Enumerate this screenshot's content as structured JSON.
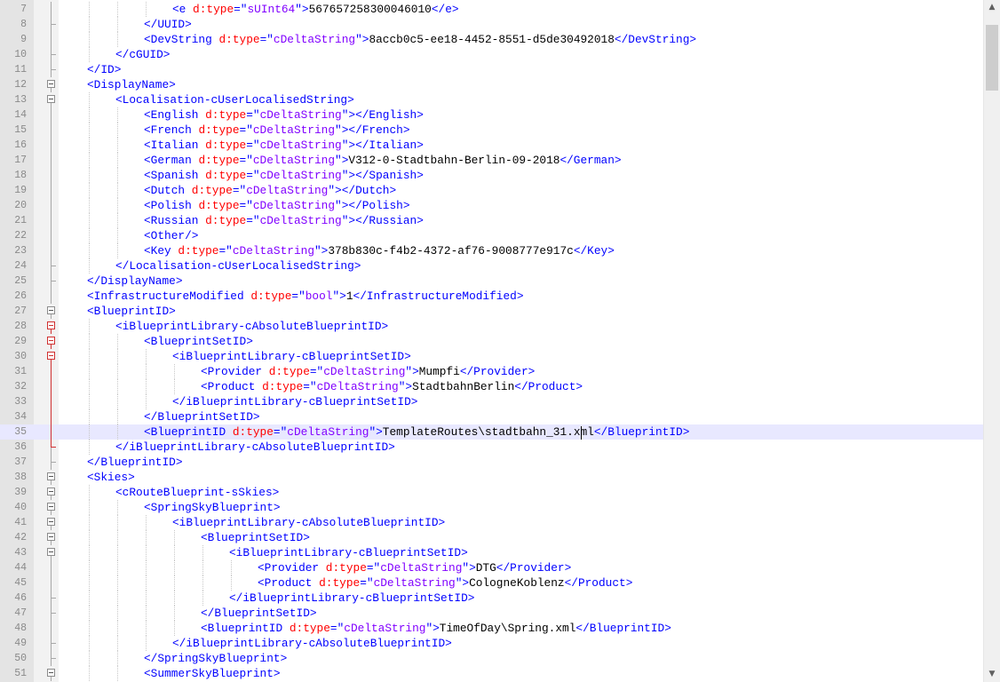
{
  "editor": {
    "caret_line": 35,
    "lines": [
      {
        "n": "7",
        "indent": 4,
        "fold": "line",
        "s": [
          [
            "t",
            "<e "
          ],
          [
            "a",
            "d:type"
          ],
          [
            "t",
            "=\""
          ],
          [
            "v",
            "sUInt64"
          ],
          [
            "t",
            "\">"
          ],
          [
            "x",
            "567657258300046010"
          ],
          [
            "t",
            "</e>"
          ]
        ]
      },
      {
        "n": "8",
        "indent": 3,
        "fold": "end",
        "s": [
          [
            "t",
            "</UUID>"
          ]
        ]
      },
      {
        "n": "9",
        "indent": 3,
        "fold": "line",
        "s": [
          [
            "t",
            "<DevString "
          ],
          [
            "a",
            "d:type"
          ],
          [
            "t",
            "=\""
          ],
          [
            "v",
            "cDeltaString"
          ],
          [
            "t",
            "\">"
          ],
          [
            "x",
            "8accb0c5-ee18-4452-8551-d5de30492018"
          ],
          [
            "t",
            "</DevString>"
          ]
        ]
      },
      {
        "n": "10",
        "indent": 2,
        "fold": "end",
        "s": [
          [
            "t",
            "</cGUID>"
          ]
        ]
      },
      {
        "n": "11",
        "indent": 1,
        "fold": "end",
        "s": [
          [
            "t",
            "</ID>"
          ]
        ]
      },
      {
        "n": "12",
        "indent": 1,
        "fold": "box",
        "s": [
          [
            "t",
            "<DisplayName>"
          ]
        ]
      },
      {
        "n": "13",
        "indent": 2,
        "fold": "box",
        "s": [
          [
            "t",
            "<Localisation-cUserLocalisedString>"
          ]
        ]
      },
      {
        "n": "14",
        "indent": 3,
        "fold": "line",
        "s": [
          [
            "t",
            "<English "
          ],
          [
            "a",
            "d:type"
          ],
          [
            "t",
            "=\""
          ],
          [
            "v",
            "cDeltaString"
          ],
          [
            "t",
            "\"></English>"
          ]
        ]
      },
      {
        "n": "15",
        "indent": 3,
        "fold": "line",
        "s": [
          [
            "t",
            "<French "
          ],
          [
            "a",
            "d:type"
          ],
          [
            "t",
            "=\""
          ],
          [
            "v",
            "cDeltaString"
          ],
          [
            "t",
            "\"></French>"
          ]
        ]
      },
      {
        "n": "16",
        "indent": 3,
        "fold": "line",
        "s": [
          [
            "t",
            "<Italian "
          ],
          [
            "a",
            "d:type"
          ],
          [
            "t",
            "=\""
          ],
          [
            "v",
            "cDeltaString"
          ],
          [
            "t",
            "\"></Italian>"
          ]
        ]
      },
      {
        "n": "17",
        "indent": 3,
        "fold": "line",
        "s": [
          [
            "t",
            "<German "
          ],
          [
            "a",
            "d:type"
          ],
          [
            "t",
            "=\""
          ],
          [
            "v",
            "cDeltaString"
          ],
          [
            "t",
            "\">"
          ],
          [
            "x",
            "V312-0-Stadtbahn-Berlin-09-2018"
          ],
          [
            "t",
            "</German>"
          ]
        ]
      },
      {
        "n": "18",
        "indent": 3,
        "fold": "line",
        "s": [
          [
            "t",
            "<Spanish "
          ],
          [
            "a",
            "d:type"
          ],
          [
            "t",
            "=\""
          ],
          [
            "v",
            "cDeltaString"
          ],
          [
            "t",
            "\"></Spanish>"
          ]
        ]
      },
      {
        "n": "19",
        "indent": 3,
        "fold": "line",
        "s": [
          [
            "t",
            "<Dutch "
          ],
          [
            "a",
            "d:type"
          ],
          [
            "t",
            "=\""
          ],
          [
            "v",
            "cDeltaString"
          ],
          [
            "t",
            "\"></Dutch>"
          ]
        ]
      },
      {
        "n": "20",
        "indent": 3,
        "fold": "line",
        "s": [
          [
            "t",
            "<Polish "
          ],
          [
            "a",
            "d:type"
          ],
          [
            "t",
            "=\""
          ],
          [
            "v",
            "cDeltaString"
          ],
          [
            "t",
            "\"></Polish>"
          ]
        ]
      },
      {
        "n": "21",
        "indent": 3,
        "fold": "line",
        "s": [
          [
            "t",
            "<Russian "
          ],
          [
            "a",
            "d:type"
          ],
          [
            "t",
            "=\""
          ],
          [
            "v",
            "cDeltaString"
          ],
          [
            "t",
            "\"></Russian>"
          ]
        ]
      },
      {
        "n": "22",
        "indent": 3,
        "fold": "line",
        "s": [
          [
            "t",
            "<Other/>"
          ]
        ]
      },
      {
        "n": "23",
        "indent": 3,
        "fold": "line",
        "s": [
          [
            "t",
            "<Key "
          ],
          [
            "a",
            "d:type"
          ],
          [
            "t",
            "=\""
          ],
          [
            "v",
            "cDeltaString"
          ],
          [
            "t",
            "\">"
          ],
          [
            "x",
            "378b830c-f4b2-4372-af76-9008777e917c"
          ],
          [
            "t",
            "</Key>"
          ]
        ]
      },
      {
        "n": "24",
        "indent": 2,
        "fold": "end",
        "s": [
          [
            "t",
            "</Localisation-cUserLocalisedString>"
          ]
        ]
      },
      {
        "n": "25",
        "indent": 1,
        "fold": "end",
        "s": [
          [
            "t",
            "</DisplayName>"
          ]
        ]
      },
      {
        "n": "26",
        "indent": 1,
        "fold": "line",
        "s": [
          [
            "t",
            "<InfrastructureModified "
          ],
          [
            "a",
            "d:type"
          ],
          [
            "t",
            "=\""
          ],
          [
            "v",
            "bool"
          ],
          [
            "t",
            "\">"
          ],
          [
            "x",
            "1"
          ],
          [
            "t",
            "</InfrastructureModified>"
          ]
        ]
      },
      {
        "n": "27",
        "indent": 1,
        "fold": "box",
        "s": [
          [
            "t",
            "<BlueprintID>"
          ]
        ]
      },
      {
        "n": "28",
        "indent": 2,
        "fold": "box-red",
        "s": [
          [
            "t",
            "<iBlueprintLibrary-cAbsoluteBlueprintID>"
          ]
        ]
      },
      {
        "n": "29",
        "indent": 3,
        "fold": "box-red",
        "s": [
          [
            "t",
            "<BlueprintSetID>"
          ]
        ]
      },
      {
        "n": "30",
        "indent": 4,
        "fold": "box-red",
        "s": [
          [
            "t",
            "<iBlueprintLibrary-cBlueprintSetID>"
          ]
        ]
      },
      {
        "n": "31",
        "indent": 5,
        "fold": "line-red",
        "s": [
          [
            "t",
            "<Provider "
          ],
          [
            "a",
            "d:type"
          ],
          [
            "t",
            "=\""
          ],
          [
            "v",
            "cDeltaString"
          ],
          [
            "t",
            "\">"
          ],
          [
            "x",
            "Mumpfi"
          ],
          [
            "t",
            "</Provider>"
          ]
        ]
      },
      {
        "n": "32",
        "indent": 5,
        "fold": "line-red",
        "s": [
          [
            "t",
            "<Product "
          ],
          [
            "a",
            "d:type"
          ],
          [
            "t",
            "=\""
          ],
          [
            "v",
            "cDeltaString"
          ],
          [
            "t",
            "\">"
          ],
          [
            "x",
            "StadtbahnBerlin"
          ],
          [
            "t",
            "</Product>"
          ]
        ]
      },
      {
        "n": "33",
        "indent": 4,
        "fold": "line-red",
        "s": [
          [
            "t",
            "</iBlueprintLibrary-cBlueprintSetID>"
          ]
        ]
      },
      {
        "n": "34",
        "indent": 3,
        "fold": "line-red",
        "s": [
          [
            "t",
            "</BlueprintSetID>"
          ]
        ]
      },
      {
        "n": "35",
        "indent": 3,
        "fold": "line-red",
        "s": [
          [
            "t",
            "<BlueprintID "
          ],
          [
            "a",
            "d:type"
          ],
          [
            "t",
            "=\""
          ],
          [
            "v",
            "cDeltaString"
          ],
          [
            "t",
            "\">"
          ],
          [
            "x",
            "TemplateRoutes\\stadtbahn_31.xml"
          ],
          [
            "t",
            "</BlueprintID>"
          ]
        ]
      },
      {
        "n": "36",
        "indent": 2,
        "fold": "end-red",
        "s": [
          [
            "t",
            "</iBlueprintLibrary-cAbsoluteBlueprintID>"
          ]
        ]
      },
      {
        "n": "37",
        "indent": 1,
        "fold": "end",
        "s": [
          [
            "t",
            "</BlueprintID>"
          ]
        ]
      },
      {
        "n": "38",
        "indent": 1,
        "fold": "box",
        "s": [
          [
            "t",
            "<Skies>"
          ]
        ]
      },
      {
        "n": "39",
        "indent": 2,
        "fold": "box",
        "s": [
          [
            "t",
            "<cRouteBlueprint-sSkies>"
          ]
        ]
      },
      {
        "n": "40",
        "indent": 3,
        "fold": "box",
        "s": [
          [
            "t",
            "<SpringSkyBlueprint>"
          ]
        ]
      },
      {
        "n": "41",
        "indent": 4,
        "fold": "box",
        "s": [
          [
            "t",
            "<iBlueprintLibrary-cAbsoluteBlueprintID>"
          ]
        ]
      },
      {
        "n": "42",
        "indent": 5,
        "fold": "box",
        "s": [
          [
            "t",
            "<BlueprintSetID>"
          ]
        ]
      },
      {
        "n": "43",
        "indent": 6,
        "fold": "box",
        "s": [
          [
            "t",
            "<iBlueprintLibrary-cBlueprintSetID>"
          ]
        ]
      },
      {
        "n": "44",
        "indent": 7,
        "fold": "line",
        "s": [
          [
            "t",
            "<Provider "
          ],
          [
            "a",
            "d:type"
          ],
          [
            "t",
            "=\""
          ],
          [
            "v",
            "cDeltaString"
          ],
          [
            "t",
            "\">"
          ],
          [
            "x",
            "DTG"
          ],
          [
            "t",
            "</Provider>"
          ]
        ]
      },
      {
        "n": "45",
        "indent": 7,
        "fold": "line",
        "s": [
          [
            "t",
            "<Product "
          ],
          [
            "a",
            "d:type"
          ],
          [
            "t",
            "=\""
          ],
          [
            "v",
            "cDeltaString"
          ],
          [
            "t",
            "\">"
          ],
          [
            "x",
            "CologneKoblenz"
          ],
          [
            "t",
            "</Product>"
          ]
        ]
      },
      {
        "n": "46",
        "indent": 6,
        "fold": "end",
        "s": [
          [
            "t",
            "</iBlueprintLibrary-cBlueprintSetID>"
          ]
        ]
      },
      {
        "n": "47",
        "indent": 5,
        "fold": "end",
        "s": [
          [
            "t",
            "</BlueprintSetID>"
          ]
        ]
      },
      {
        "n": "48",
        "indent": 5,
        "fold": "line",
        "s": [
          [
            "t",
            "<BlueprintID "
          ],
          [
            "a",
            "d:type"
          ],
          [
            "t",
            "=\""
          ],
          [
            "v",
            "cDeltaString"
          ],
          [
            "t",
            "\">"
          ],
          [
            "x",
            "TimeOfDay\\Spring.xml"
          ],
          [
            "t",
            "</BlueprintID>"
          ]
        ]
      },
      {
        "n": "49",
        "indent": 4,
        "fold": "end",
        "s": [
          [
            "t",
            "</iBlueprintLibrary-cAbsoluteBlueprintID>"
          ]
        ]
      },
      {
        "n": "50",
        "indent": 3,
        "fold": "end",
        "s": [
          [
            "t",
            "</SpringSkyBlueprint>"
          ]
        ]
      },
      {
        "n": "51",
        "indent": 3,
        "fold": "box",
        "s": [
          [
            "t",
            "<SummerSkyBlueprint>"
          ]
        ]
      }
    ]
  },
  "scrollbar": {
    "up_icon": "chevron-up-icon",
    "down_icon": "chevron-down-icon",
    "up_glyph": "▲",
    "down_glyph": "▼"
  },
  "colors": {
    "tag": "#0000ff",
    "attribute": "#ff0000",
    "attribute_value": "#8000ff",
    "text": "#000000",
    "current_line": "#e8e8ff",
    "fold_active": "#d03030"
  }
}
